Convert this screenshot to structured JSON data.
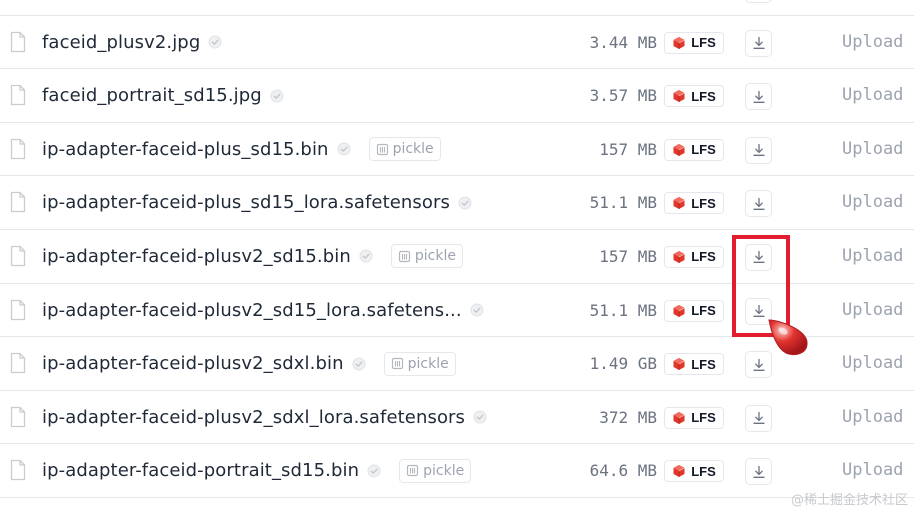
{
  "files": [
    {
      "name": "faceid_plusv2.jpg",
      "size": "",
      "upload": "Upload",
      "pickle": false
    },
    {
      "name": "faceid_plusv2.jpg",
      "size": "3.44 MB",
      "upload": "Upload",
      "pickle": false
    },
    {
      "name": "faceid_portrait_sd15.jpg",
      "size": "3.57 MB",
      "upload": "Upload",
      "pickle": false
    },
    {
      "name": "ip-adapter-faceid-plus_sd15.bin",
      "size": "157 MB",
      "upload": "Upload",
      "pickle": true
    },
    {
      "name": "ip-adapter-faceid-plus_sd15_lora.safetensors",
      "size": "51.1 MB",
      "upload": "Upload",
      "pickle": false
    },
    {
      "name": "ip-adapter-faceid-plusv2_sd15.bin",
      "size": "157 MB",
      "upload": "Upload",
      "pickle": true
    },
    {
      "name": "ip-adapter-faceid-plusv2_sd15_lora.safetens...",
      "size": "51.1 MB",
      "upload": "Upload",
      "pickle": false
    },
    {
      "name": "ip-adapter-faceid-plusv2_sdxl.bin",
      "size": "1.49 GB",
      "upload": "Upload",
      "pickle": true
    },
    {
      "name": "ip-adapter-faceid-plusv2_sdxl_lora.safetensors",
      "size": "372 MB",
      "upload": "Upload",
      "pickle": false
    },
    {
      "name": "ip-adapter-faceid-portrait_sd15.bin",
      "size": "64.6 MB",
      "upload": "Upload",
      "pickle": true
    }
  ],
  "labels": {
    "lfs": "LFS",
    "pickle": "pickle"
  },
  "icons": {
    "file": "file-icon",
    "verified": "check-shield-icon",
    "pickle": "pickle-icon",
    "lfs": "lfs-cube-icon",
    "download": "download-icon",
    "cursor": "mouse-cursor-icon"
  },
  "colors": {
    "highlight": "#e11d2e",
    "lfs_cube": "#e0362b",
    "cursor": "#e2342f"
  },
  "watermark": "@稀土掘金技术社区"
}
